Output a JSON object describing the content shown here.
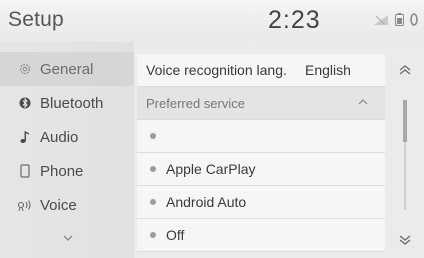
{
  "header": {
    "title": "Setup",
    "clock": "2:23"
  },
  "sidebar": {
    "items": [
      {
        "label": "General",
        "icon": "gear-icon",
        "active": true
      },
      {
        "label": "Bluetooth",
        "icon": "bluetooth-icon"
      },
      {
        "label": "Audio",
        "icon": "music-note-icon"
      },
      {
        "label": "Phone",
        "icon": "phone-icon"
      },
      {
        "label": "Voice",
        "icon": "voice-icon"
      }
    ],
    "more_icon": "chevron-down-icon"
  },
  "settings": {
    "voice_lang_label": "Voice recognition lang.",
    "voice_lang_value": "English",
    "preferred_label": "Preferred service",
    "options": [
      "",
      "Apple CarPlay",
      "Android Auto",
      "Off"
    ]
  },
  "scroll": {
    "up_icon": "double-chevron-up-icon",
    "down_icon": "double-chevron-down-icon"
  }
}
